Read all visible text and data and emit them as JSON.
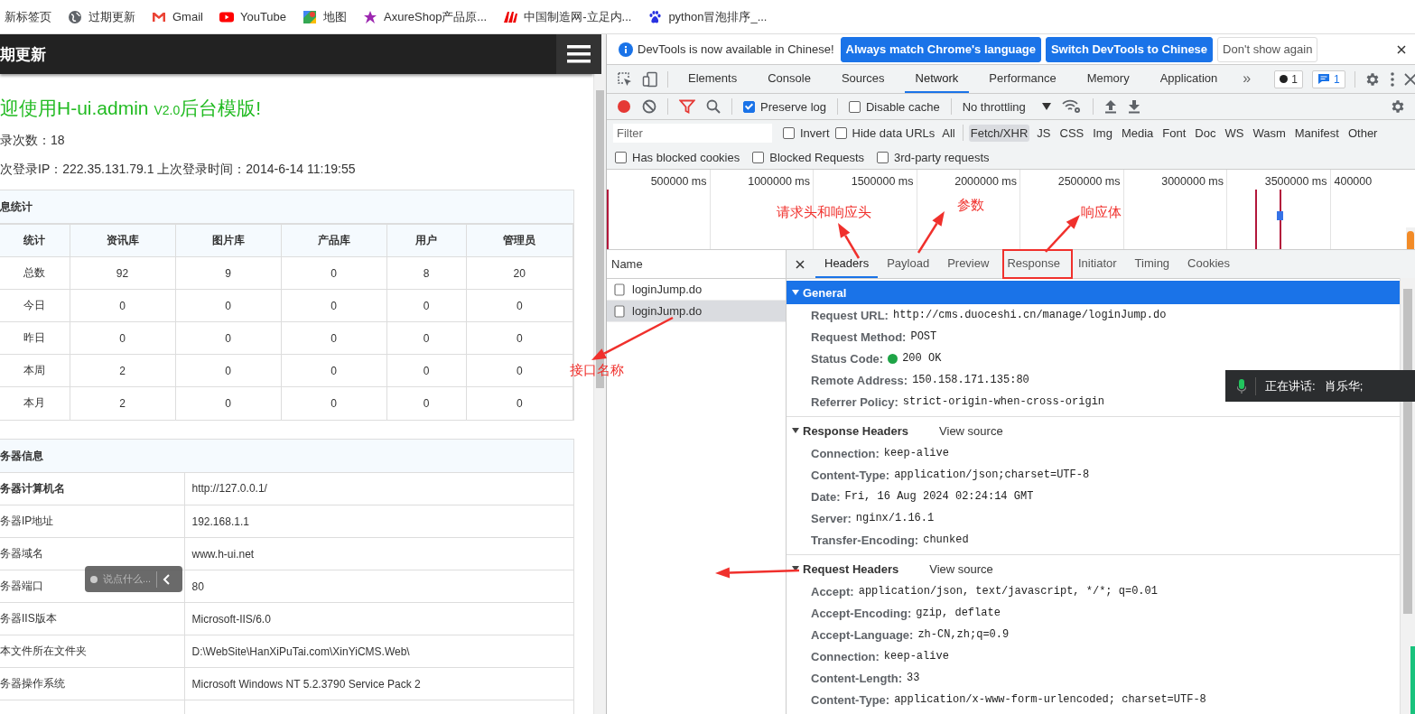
{
  "bookmarks": [
    {
      "label": "新标签页",
      "kind": "plain"
    },
    {
      "label": "过期更新",
      "kind": "globe"
    },
    {
      "label": "Gmail",
      "kind": "gmail"
    },
    {
      "label": "YouTube",
      "kind": "youtube"
    },
    {
      "label": "地图",
      "kind": "maps"
    },
    {
      "label": "AxureShop产品原...",
      "kind": "star"
    },
    {
      "label": "中国制造网-立足内...",
      "kind": "made"
    },
    {
      "label": "python冒泡排序_...",
      "kind": "paw"
    }
  ],
  "page": {
    "header_title": "期更新",
    "welcome": {
      "lead": "迎使用H-ui.admin ",
      "version": "V2.0",
      "tail": "后台模版!"
    },
    "lines": [
      "录次数：18",
      "次登录IP：222.35.131.79.1 上次登录时间：2014-6-14 11:19:55"
    ],
    "stats": {
      "title": "息统计",
      "columns": [
        "统计",
        "资讯库",
        "图片库",
        "产品库",
        "用户",
        "管理员"
      ],
      "rows": [
        [
          "总数",
          "92",
          "9",
          "0",
          "8",
          "20"
        ],
        [
          "今日",
          "0",
          "0",
          "0",
          "0",
          "0"
        ],
        [
          "昨日",
          "0",
          "0",
          "0",
          "0",
          "0"
        ],
        [
          "本周",
          "2",
          "0",
          "0",
          "0",
          "0"
        ],
        [
          "本月",
          "2",
          "0",
          "0",
          "0",
          "0"
        ]
      ]
    },
    "server": {
      "title": "务器信息",
      "rows": [
        {
          "label": "务器计算机名",
          "value": "http://127.0.0.1/",
          "emphasized": true
        },
        {
          "label": "务器IP地址",
          "value": "192.168.1.1",
          "emphasized": false
        },
        {
          "label": "务器域名",
          "value": "www.h-ui.net",
          "emphasized": false
        },
        {
          "label": "务器端口",
          "value": "80",
          "emphasized": false
        },
        {
          "label": "务器IIS版本",
          "value": "Microsoft-IIS/6.0",
          "emphasized": false
        },
        {
          "label": "本文件所在文件夹",
          "value": "D:\\WebSite\\HanXiPuTai.com\\XinYiCMS.Web\\",
          "emphasized": false
        },
        {
          "label": "务器操作系统",
          "value": "Microsoft Windows NT 5.2.3790 Service Pack 2",
          "emphasized": false
        }
      ]
    },
    "chat_pill": {
      "placeholder": "说点什么..."
    }
  },
  "devtools": {
    "infobar": {
      "message": "DevTools is now available in Chinese!",
      "buttons": [
        {
          "label": "Always match Chrome's language",
          "kind": "primary"
        },
        {
          "label": "Switch DevTools to Chinese",
          "kind": "primary"
        },
        {
          "label": "Don't show again",
          "kind": "secondary"
        }
      ]
    },
    "tabs": [
      {
        "label": "Elements",
        "selected": false
      },
      {
        "label": "Console",
        "selected": false
      },
      {
        "label": "Sources",
        "selected": false
      },
      {
        "label": "Network",
        "selected": true
      },
      {
        "label": "Performance",
        "selected": false
      },
      {
        "label": "Memory",
        "selected": false
      },
      {
        "label": "Application",
        "selected": false
      }
    ],
    "more_tabs": "»",
    "error_count": "1",
    "message_count": "1",
    "toolbar": {
      "options": [
        {
          "label": "Preserve log",
          "checked": true
        },
        {
          "label": "Disable cache",
          "checked": false
        }
      ],
      "throttling": "No throttling"
    },
    "filter": {
      "placeholder": "Filter",
      "options": [
        {
          "label": "Invert",
          "checked": false
        },
        {
          "label": "Hide data URLs",
          "checked": false
        }
      ],
      "types": [
        {
          "label": "All",
          "selected": false
        },
        {
          "label": "Fetch/XHR",
          "selected": true
        },
        {
          "label": "JS",
          "selected": false
        },
        {
          "label": "CSS",
          "selected": false
        },
        {
          "label": "Img",
          "selected": false
        },
        {
          "label": "Media",
          "selected": false
        },
        {
          "label": "Font",
          "selected": false
        },
        {
          "label": "Doc",
          "selected": false
        },
        {
          "label": "WS",
          "selected": false
        },
        {
          "label": "Wasm",
          "selected": false
        },
        {
          "label": "Manifest",
          "selected": false
        },
        {
          "label": "Other",
          "selected": false
        }
      ],
      "more_options": [
        {
          "label": "Has blocked cookies",
          "checked": false
        },
        {
          "label": "Blocked Requests",
          "checked": false
        },
        {
          "label": "3rd-party requests",
          "checked": false
        }
      ]
    },
    "timeline_ticks": [
      "500000 ms",
      "1000000 ms",
      "1500000 ms",
      "2000000 ms",
      "2500000 ms",
      "3000000 ms",
      "3500000 ms",
      "400000"
    ],
    "requests": {
      "header": "Name",
      "items": [
        {
          "name": "loginJump.do",
          "selected": false
        },
        {
          "name": "loginJump.do",
          "selected": true
        }
      ]
    },
    "detail_tabs": [
      {
        "label": "Headers",
        "selected": true
      },
      {
        "label": "Payload",
        "selected": false
      },
      {
        "label": "Preview",
        "selected": false
      },
      {
        "label": "Response",
        "selected": false
      },
      {
        "label": "Initiator",
        "selected": false
      },
      {
        "label": "Timing",
        "selected": false
      },
      {
        "label": "Cookies",
        "selected": false
      }
    ],
    "sections": [
      {
        "title": "General",
        "kind": "general",
        "expanded": true,
        "rows": [
          {
            "key": "Request URL:",
            "value": "http://cms.duoceshi.cn/manage/loginJump.do",
            "kind": "text"
          },
          {
            "key": "Request Method:",
            "value": "POST",
            "kind": "text"
          },
          {
            "key": "Status Code:",
            "value": "200 OK",
            "kind": "status"
          },
          {
            "key": "Remote Address:",
            "value": "150.158.171.135:80",
            "kind": "text"
          },
          {
            "key": "Referrer Policy:",
            "value": "strict-origin-when-cross-origin",
            "kind": "text"
          }
        ]
      },
      {
        "title": "Response Headers",
        "kind": "headers",
        "view_source": "View source",
        "expanded": true,
        "rows": [
          {
            "key": "Connection:",
            "value": "keep-alive",
            "kind": "text"
          },
          {
            "key": "Content-Type:",
            "value": "application/json;charset=UTF-8",
            "kind": "text"
          },
          {
            "key": "Date:",
            "value": "Fri, 16 Aug 2024 02:24:14 GMT",
            "kind": "text"
          },
          {
            "key": "Server:",
            "value": "nginx/1.16.1",
            "kind": "text"
          },
          {
            "key": "Transfer-Encoding:",
            "value": "chunked",
            "kind": "text"
          }
        ]
      },
      {
        "title": "Request Headers",
        "kind": "headers",
        "view_source": "View source",
        "expanded": true,
        "rows": [
          {
            "key": "Accept:",
            "value": "application/json, text/javascript, */*; q=0.01",
            "kind": "text"
          },
          {
            "key": "Accept-Encoding:",
            "value": "gzip, deflate",
            "kind": "text"
          },
          {
            "key": "Accept-Language:",
            "value": "zh-CN,zh;q=0.9",
            "kind": "text"
          },
          {
            "key": "Connection:",
            "value": "keep-alive",
            "kind": "text"
          },
          {
            "key": "Content-Length:",
            "value": "33",
            "kind": "text"
          },
          {
            "key": "Content-Type:",
            "value": "application/x-www-form-urlencoded; charset=UTF-8",
            "kind": "text"
          }
        ]
      }
    ]
  },
  "annotations": [
    "请求头和响应头",
    "参数",
    "响应体",
    "接口名称"
  ],
  "voice_toast": {
    "label": "正在讲话:",
    "speaker": "肖乐华;"
  }
}
